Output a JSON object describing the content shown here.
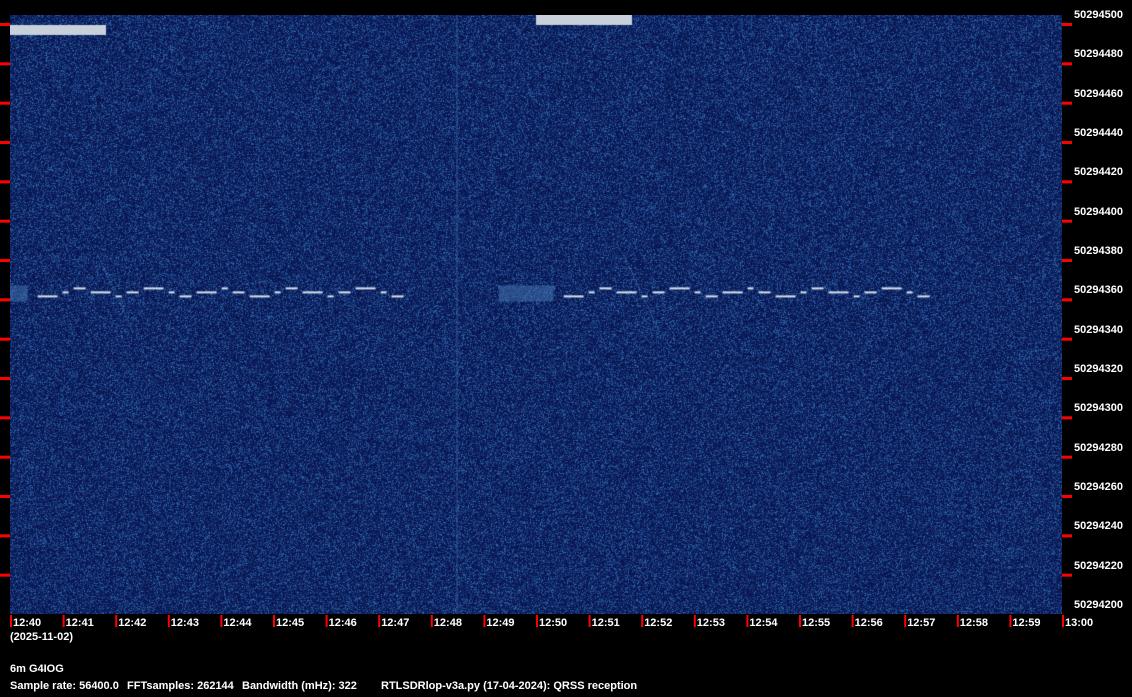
{
  "chart_data": {
    "type": "heatmap",
    "xlabel": "",
    "ylabel": "",
    "x_ticks": [
      "12:40",
      "12:41",
      "12:42",
      "12:43",
      "12:44",
      "12:45",
      "12:46",
      "12:47",
      "12:48",
      "12:49",
      "12:50",
      "12:51",
      "12:52",
      "12:53",
      "12:54",
      "12:55",
      "12:56",
      "12:57",
      "12:58",
      "12:59",
      "13:00"
    ],
    "x_range": [
      "12:40",
      "13:00"
    ],
    "y_ticks": [
      "50294500",
      "50294480",
      "50294460",
      "50294440",
      "50294420",
      "50294400",
      "50294380",
      "50294360",
      "50294340",
      "50294320",
      "50294300",
      "50294280",
      "50294260",
      "50294240",
      "50294220",
      "50294200"
    ],
    "y_range": [
      50294200,
      50294500
    ],
    "signals": [
      {
        "start": "12:41",
        "end": "12:47",
        "freq": 50294362
      },
      {
        "start": "12:51",
        "end": "12:57",
        "freq": 50294362
      }
    ],
    "colors": {
      "background": "#0a1a5a",
      "signal": "#d8e4f0",
      "tick": "#ff0000"
    }
  },
  "date": "(2025-11-02)",
  "station": "6m G4IOG",
  "info": {
    "sample_rate": "Sample rate: 56400.0",
    "fft_samples": "FFTsamples: 262144",
    "bandwidth": "Bandwidth (mHz): 322",
    "program": "RTLSDRlop-v3a.py (17-04-2024): QRSS reception"
  }
}
